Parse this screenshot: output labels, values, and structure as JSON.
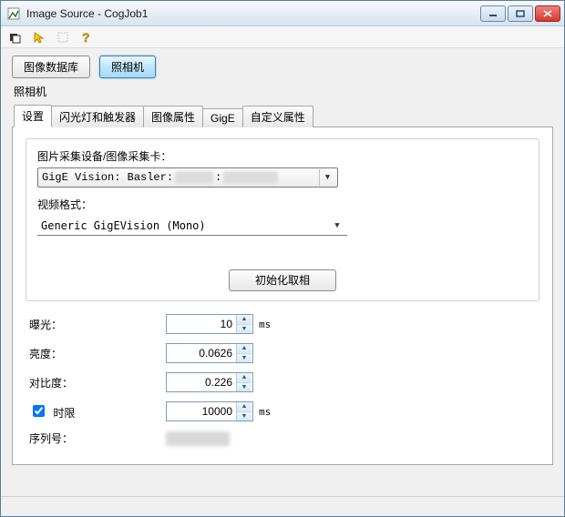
{
  "window": {
    "title": "Image Source - CogJob1"
  },
  "buttons": {
    "imageDatabase": "图像数据库",
    "camera": "照相机"
  },
  "sectionLabel": "照相机",
  "tabs": {
    "settings": "设置",
    "strobeTrigger": "闪光灯和触发器",
    "imageProps": "图像属性",
    "gige": "GigE",
    "customProps": "自定义属性"
  },
  "groupbox": {
    "deviceLabel": "图片采集设备/图像采集卡：",
    "deviceValuePrefix": "GigE Vision: Basler:",
    "videoFormatLabel": "视频格式：",
    "videoFormatValue": "Generic GigEVision (Mono)",
    "initButton": "初始化取相"
  },
  "params": {
    "exposure": {
      "label": "曝光：",
      "value": "10",
      "unit": "ms"
    },
    "brightness": {
      "label": "亮度：",
      "value": "0.0626"
    },
    "contrast": {
      "label": "对比度：",
      "value": "0.226"
    },
    "timeout": {
      "label": "时限",
      "value": "10000",
      "unit": "ms",
      "checked": true
    },
    "serial": {
      "label": "序列号："
    }
  }
}
